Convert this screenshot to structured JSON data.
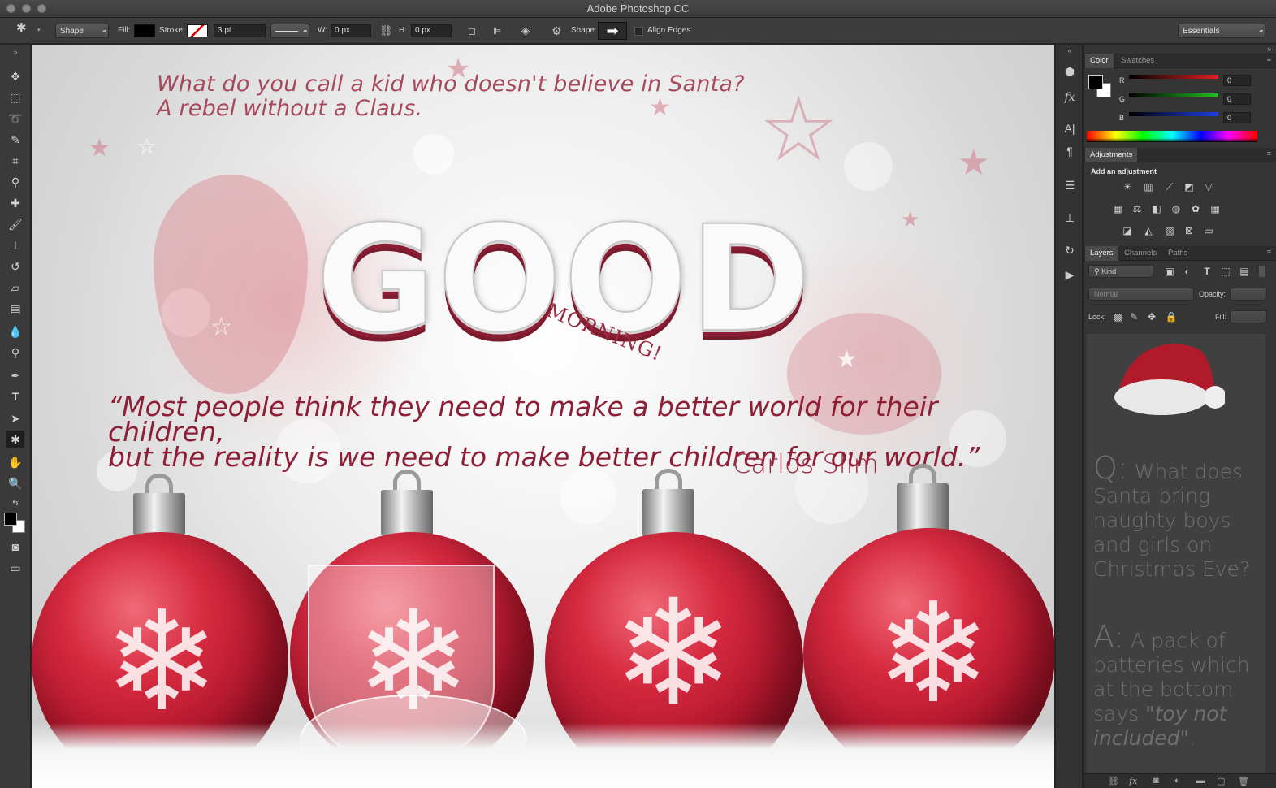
{
  "window": {
    "title": "Adobe Photoshop CC"
  },
  "options_bar": {
    "tool_mode": "Shape",
    "fill_label": "Fill:",
    "stroke_label": "Stroke:",
    "stroke_width": "3 pt",
    "w_label": "W:",
    "w_value": "0 px",
    "h_label": "H:",
    "h_value": "0 px",
    "shape_label": "Shape:",
    "align_edges_label": "Align Edges",
    "workspace": "Essentials"
  },
  "canvas": {
    "joke_line1": "What do you call a kid who doesn't believe in Santa?",
    "joke_line2": "A rebel without a Claus.",
    "headline": "GOOD",
    "subheadline": "MORNING!",
    "quote_line1": "“Most people think they need to make a better world for their children,",
    "quote_line2": "but the reality is we need to make better children for our world.”",
    "quote_author": "Carlos Slim"
  },
  "color_panel": {
    "tabs": [
      "Color",
      "Swatches"
    ],
    "channels": [
      {
        "label": "R",
        "value": "0",
        "color": "#e02020"
      },
      {
        "label": "G",
        "value": "0",
        "color": "#20c020"
      },
      {
        "label": "B",
        "value": "0",
        "color": "#2040e0"
      }
    ]
  },
  "adjustments_panel": {
    "tab": "Adjustments",
    "heading": "Add an adjustment"
  },
  "layers_panel": {
    "tabs": [
      "Layers",
      "Channels",
      "Paths"
    ],
    "filter_kind": "Kind",
    "blend_mode": "Normal",
    "opacity_label": "Opacity:",
    "lock_label": "Lock:",
    "fill_label": "Fill:"
  },
  "layer_preview": {
    "q_prefix": "Q:",
    "q_text": "What does Santa bring naughty boys and girls on Christmas Eve?",
    "a_prefix": "A:",
    "a_text_1": "A pack of batteries which at the bottom says ",
    "a_text_italic": "\"toy not included\"",
    "a_text_end": "."
  },
  "colors": {
    "accent_red": "#8e1e36",
    "ui_dark": "#282828",
    "panel": "#353535"
  }
}
